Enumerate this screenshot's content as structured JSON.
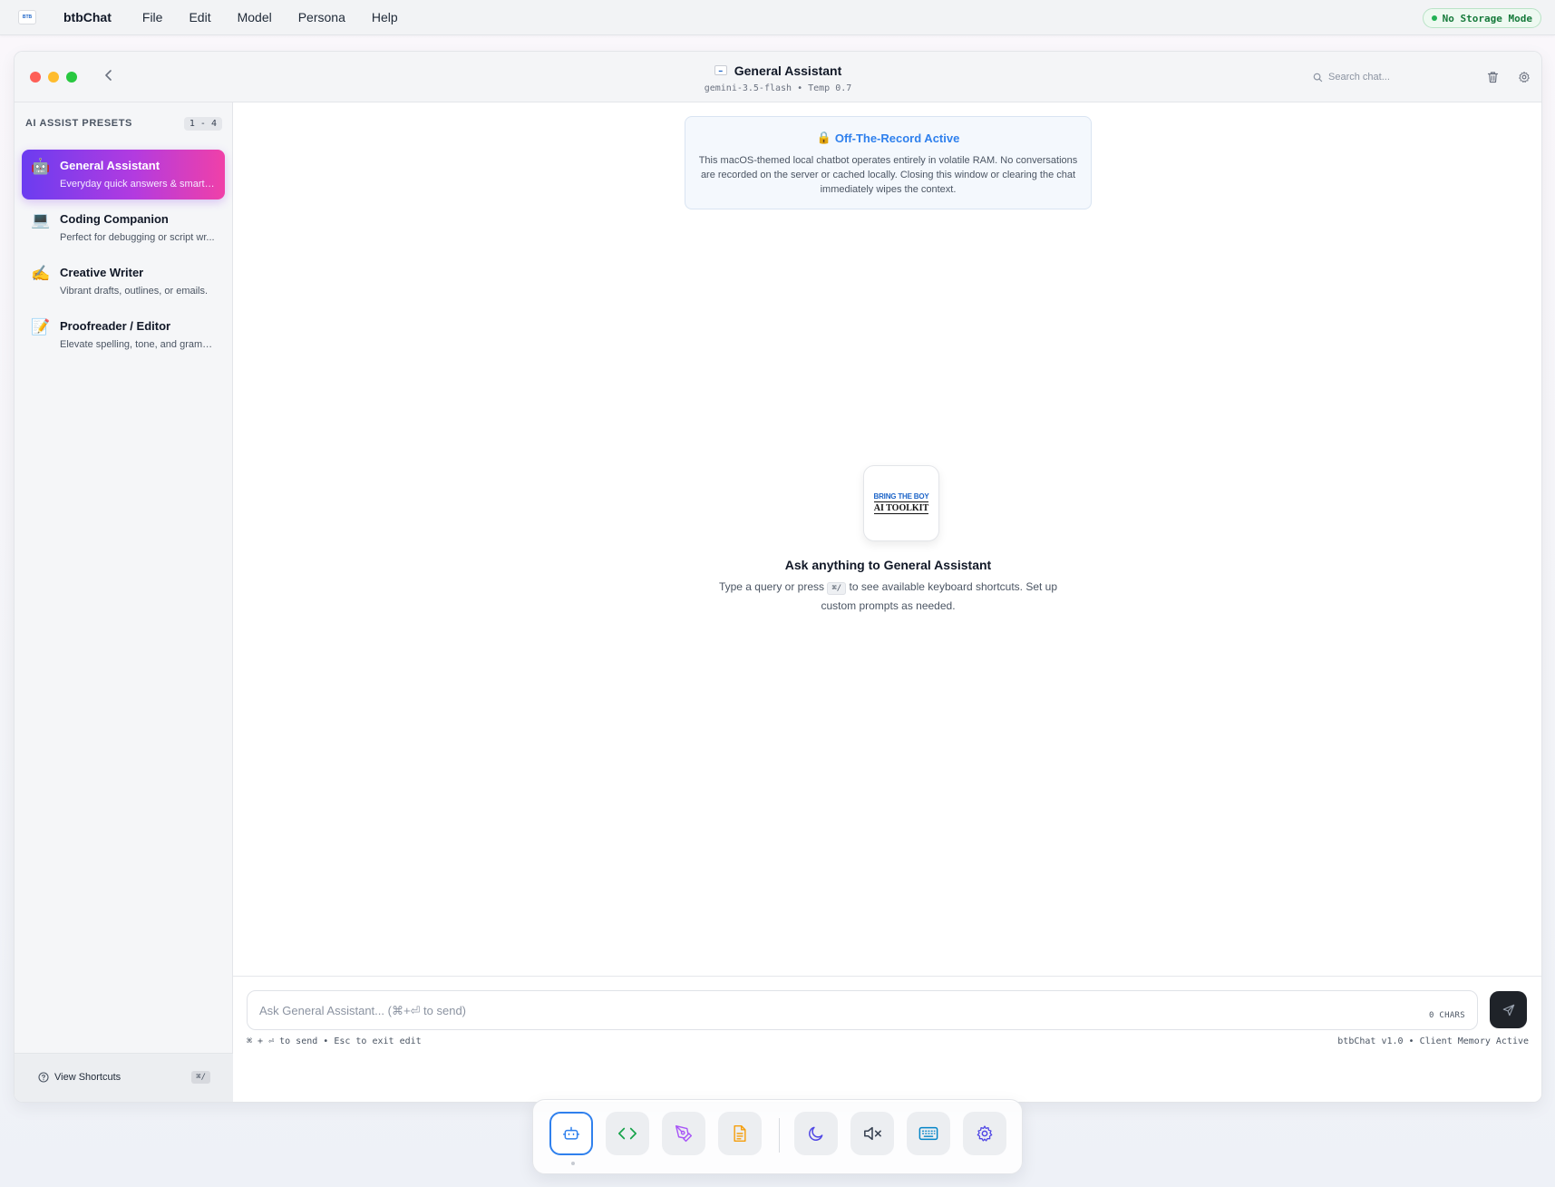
{
  "menubar": {
    "app_name": "btbChat",
    "logo_text": "BTB",
    "items": [
      "File",
      "Edit",
      "Model",
      "Persona",
      "Help"
    ],
    "storage_badge": "No Storage Mode"
  },
  "window": {
    "title": "General Assistant",
    "subtitle": "gemini-3.5-flash • Temp 0.7",
    "search_placeholder": "Search chat..."
  },
  "sidebar": {
    "header": "AI ASSIST PRESETS",
    "range": "1 - 4",
    "presets": [
      {
        "emoji": "🤖",
        "title": "General Assistant",
        "desc": "Everyday quick answers & smart r...",
        "active": true
      },
      {
        "emoji": "💻",
        "title": "Coding Companion",
        "desc": "Perfect for debugging or script wr...",
        "active": false
      },
      {
        "emoji": "✍️",
        "title": "Creative Writer",
        "desc": "Vibrant drafts, outlines, or emails.",
        "active": false
      },
      {
        "emoji": "📝",
        "title": "Proofreader / Editor",
        "desc": "Elevate spelling, tone, and gramm...",
        "active": false
      }
    ],
    "footer": {
      "label": "View Shortcuts",
      "kbd": "⌘/"
    }
  },
  "notice": {
    "icon": "🔒",
    "title": "Off-The-Record Active",
    "body": "This macOS-themed local chatbot operates entirely in volatile RAM. No conversations are recorded on the server or cached locally. Closing this window or clearing the chat immediately wipes the context."
  },
  "empty_state": {
    "logo_line1": "BRING THE BOY",
    "logo_line2": "AI TOOLKIT",
    "title": "Ask anything to General Assistant",
    "desc_before": "Type a query or press",
    "desc_kbd": "⌘/",
    "desc_after": "to see available keyboard shortcuts. Set up custom prompts as needed."
  },
  "composer": {
    "placeholder": "Ask General Assistant... (⌘+⏎ to send)",
    "char_count": "0 CHARS",
    "hint_left": "⌘ + ⏎ to send • Esc to exit edit",
    "hint_right": "btbChat v1.0 • Client Memory Active"
  },
  "dock": {
    "items": [
      {
        "icon": "robot-icon",
        "color": "#2f80ed",
        "active": true
      },
      {
        "icon": "code-icon",
        "color": "#16a34a",
        "active": false
      },
      {
        "icon": "pen-tool-icon",
        "color": "#a855f7",
        "active": false
      },
      {
        "icon": "document-icon",
        "color": "#f59e0b",
        "active": false
      },
      {
        "icon": "moon-icon",
        "color": "#4f46e5",
        "active": false
      },
      {
        "icon": "mute-icon",
        "color": "#374151",
        "active": false
      },
      {
        "icon": "keyboard-icon",
        "color": "#0284c7",
        "active": false
      },
      {
        "icon": "settings-icon",
        "color": "#4f46e5",
        "active": false
      }
    ]
  },
  "colors": {
    "accent": "#2f80ed",
    "preset_gradient": [
      "#6b3cf0",
      "#b23be0",
      "#f040a8"
    ],
    "badge_green": "#22b155"
  }
}
